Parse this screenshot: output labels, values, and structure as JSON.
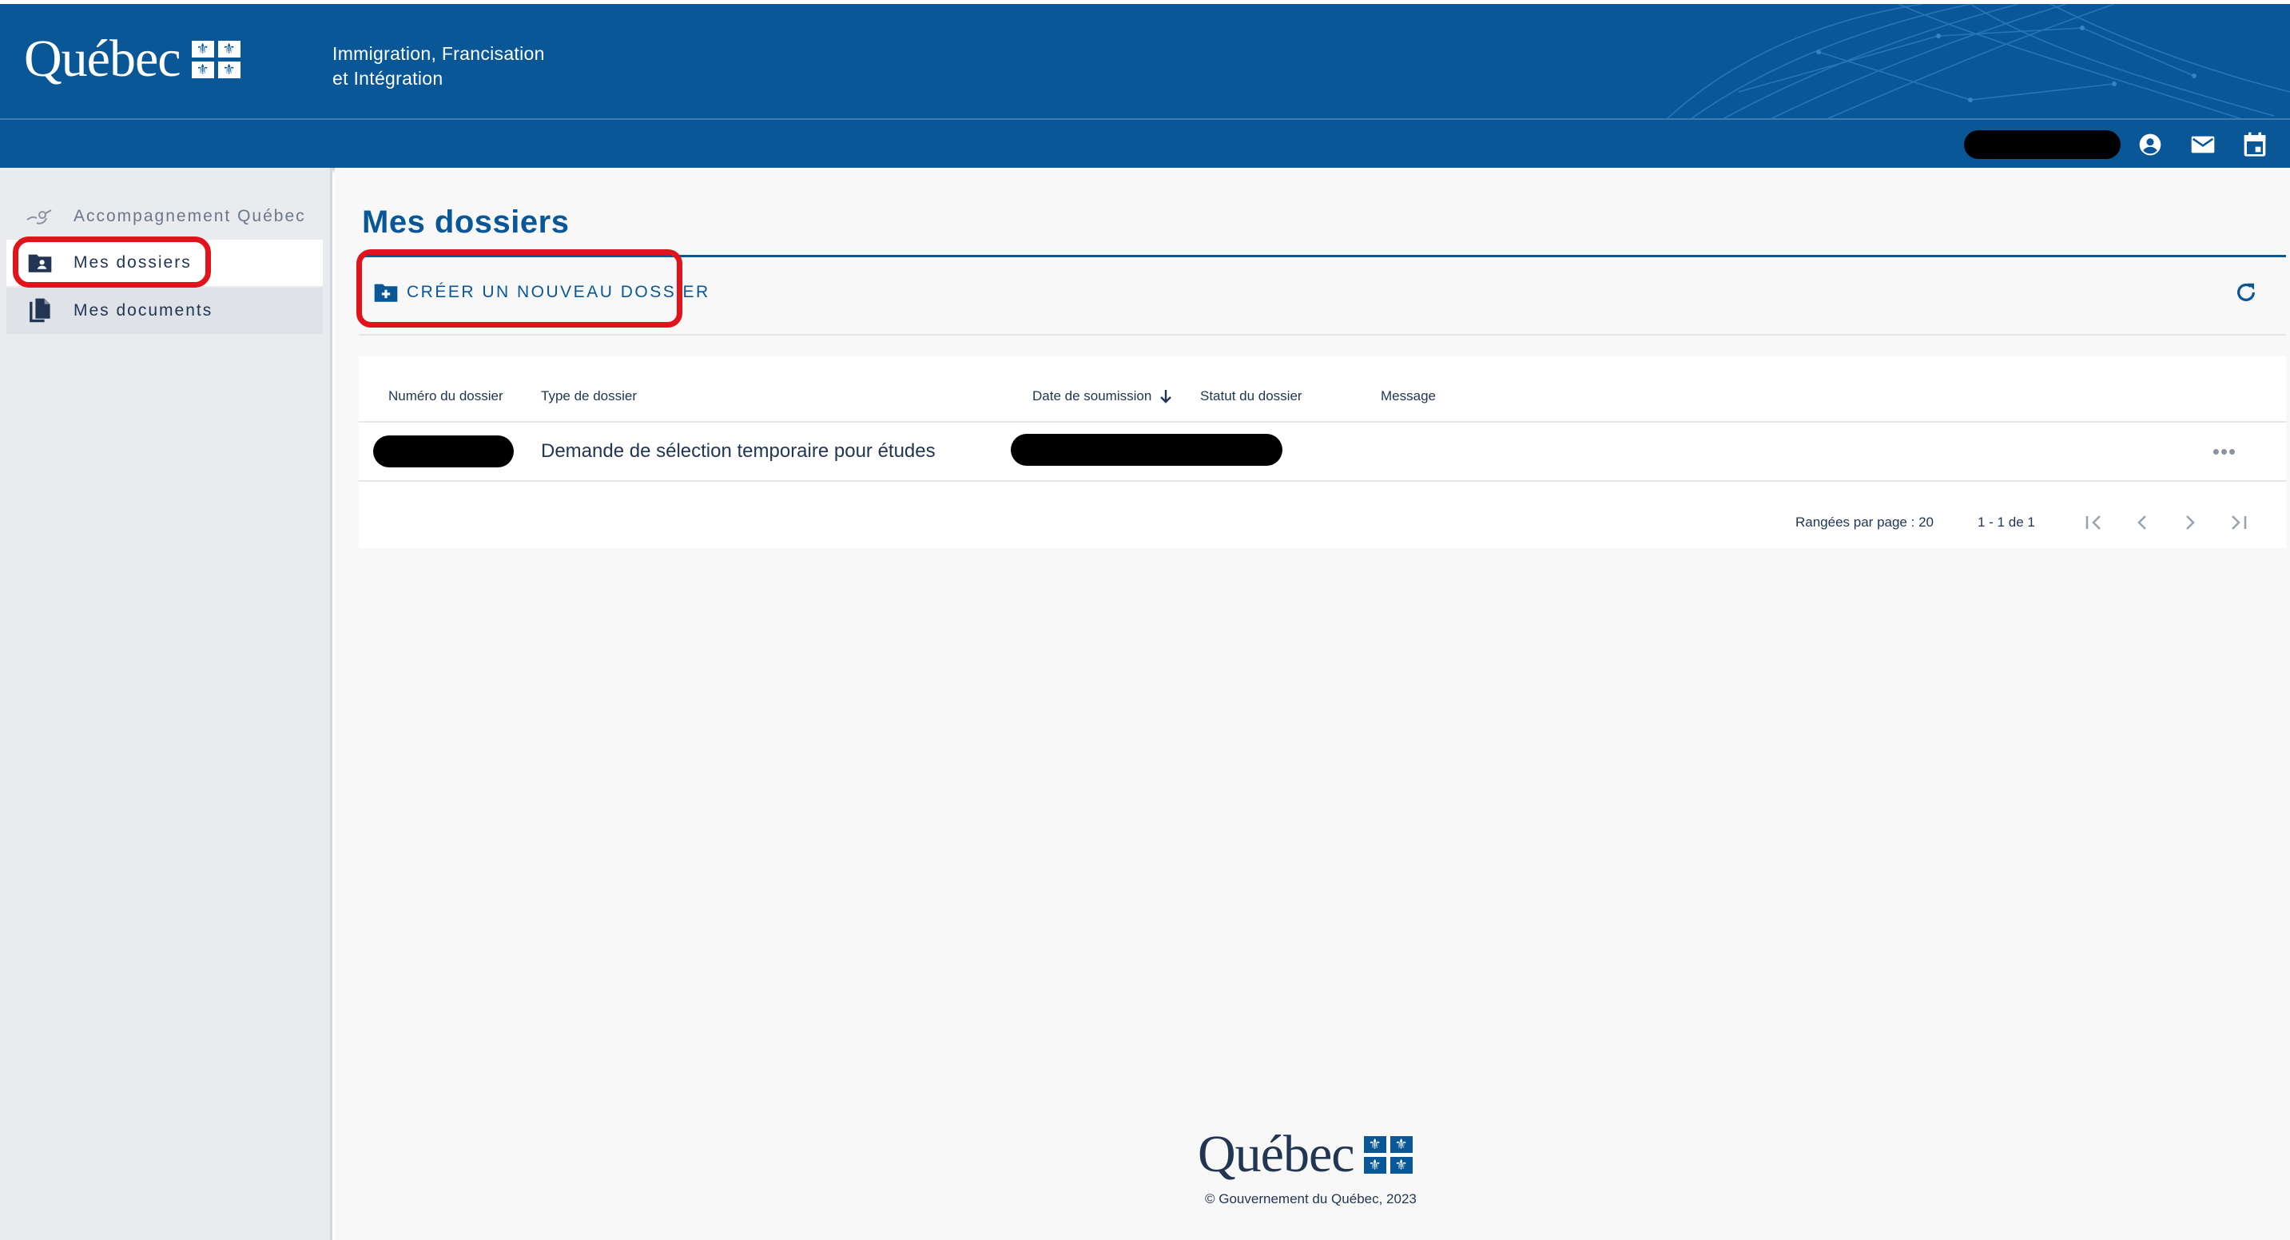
{
  "header": {
    "logo_text": "Québec",
    "ministry_line1": "Immigration, Francisation",
    "ministry_line2": "et Intégration"
  },
  "toolbar": {
    "icons": [
      "account-circle-icon",
      "mail-icon",
      "calendar-icon"
    ]
  },
  "sidebar": {
    "items": [
      {
        "label": "Accompagnement Québec",
        "icon": "accompagnement-icon"
      },
      {
        "label": "Mes dossiers",
        "icon": "folder-account-icon",
        "active": true
      },
      {
        "label": "Mes documents",
        "icon": "documents-icon"
      }
    ]
  },
  "main": {
    "title": "Mes dossiers",
    "create_button": "CRÉER UN NOUVEAU DOSSIER",
    "table": {
      "columns": [
        "Numéro du dossier",
        "Type de dossier",
        "Date de soumission",
        "Statut du dossier",
        "Message"
      ],
      "rows": [
        {
          "type": "Demande de sélection temporaire pour études"
        }
      ],
      "pagination": {
        "rows_per_page_label": "Rangées par page :",
        "rows_per_page_value": "20",
        "range": "1 - 1 de 1"
      }
    }
  },
  "footer": {
    "logo_text": "Québec",
    "copyright": "© Gouvernement du Québec, 2023"
  },
  "colors": {
    "brand_blue": "#095797",
    "annotation_red": "#e0141b",
    "text_dark": "#223654"
  }
}
